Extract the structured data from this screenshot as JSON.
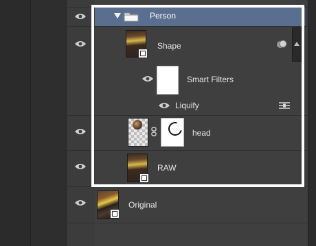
{
  "layers_panel": {
    "group": {
      "name": "Person",
      "expanded": true
    },
    "layers": [
      {
        "name": "Shape",
        "type": "smart-object",
        "visible": true
      },
      {
        "name": "Smart Filters",
        "type": "smart-filters",
        "visible": true
      },
      {
        "name": "Liquify",
        "type": "filter",
        "visible": true
      },
      {
        "name": "head",
        "type": "layer-with-mask",
        "visible": true
      },
      {
        "name": "RAW",
        "type": "smart-object",
        "visible": true
      },
      {
        "name": "Original",
        "type": "smart-object",
        "visible": true
      }
    ],
    "colors": {
      "panel_bg": "#3f3f3f",
      "selected_group_bg": "#5a6f8f",
      "highlight_border": "#ffffff"
    },
    "icons": [
      "eye-icon",
      "folder-icon",
      "disclosure-triangle-icon",
      "smart-object-badge-icon",
      "link-icon",
      "smart-filter-options-icon",
      "style-badge-icon",
      "scroll-up-arrow-icon"
    ]
  }
}
